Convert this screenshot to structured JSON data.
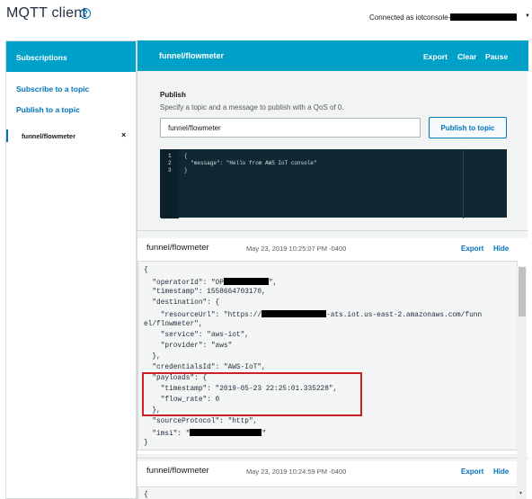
{
  "app": {
    "title": "MQTT client",
    "connection_label": "Connected as iotconsole-"
  },
  "sidebar": {
    "header": "Subscriptions",
    "subscribe_link": "Subscribe to a topic",
    "publish_link": "Publish to a topic",
    "subscriptions": [
      {
        "topic": "funnel/flowmeter",
        "close": "×"
      }
    ]
  },
  "main": {
    "header": {
      "topic": "funnel/flowmeter",
      "export": "Export",
      "clear": "Clear",
      "pause": "Pause"
    },
    "publish": {
      "label": "Publish",
      "hint": "Specify a topic and a message to publish with a QoS of 0.",
      "topic_value": "funnel/flowmeter",
      "button": "Publish to topic",
      "editor": {
        "line_numbers": [
          "1",
          "2",
          "3"
        ],
        "lines": [
          "{",
          "  \"message\": \"Hello from AWS IoT console\"",
          "}"
        ]
      }
    },
    "messages": [
      {
        "topic": "funnel/flowmeter",
        "timestamp": "May 23, 2019 10:25:07 PM -0400",
        "export": "Export",
        "hide": "Hide",
        "lines": [
          "{",
          "  \"operatorId\": \"OP",
          "  \"timestamp\": 1558664703170,",
          "  \"destination\": {",
          "    \"resourceUrl\": \"https://",
          "el/flowmeter\",",
          "    \"service\": \"aws-iot\",",
          "    \"provider\": \"aws\"",
          "  },",
          "  \"credentialsId\": \"AWS-IoT\",",
          "  \"payloads\": {",
          "    \"timestamp\": \"2019-05-23 22:25:01.335228\",",
          "    \"flow_rate\": 0",
          "  },",
          "  \"sourceProtocol\": \"http\",",
          "  \"imsi\": \"",
          "}"
        ],
        "line_tails": {
          "operator_id_end": "\",",
          "resource_url_end": "-ats.iot.us-east-2.amazonaws.com/funn",
          "imsi_end": "\""
        }
      },
      {
        "topic": "funnel/flowmeter",
        "timestamp": "May 23, 2019 10:24:59 PM -0400",
        "export": "Export",
        "hide": "Hide",
        "lines": [
          "{"
        ]
      }
    ]
  }
}
